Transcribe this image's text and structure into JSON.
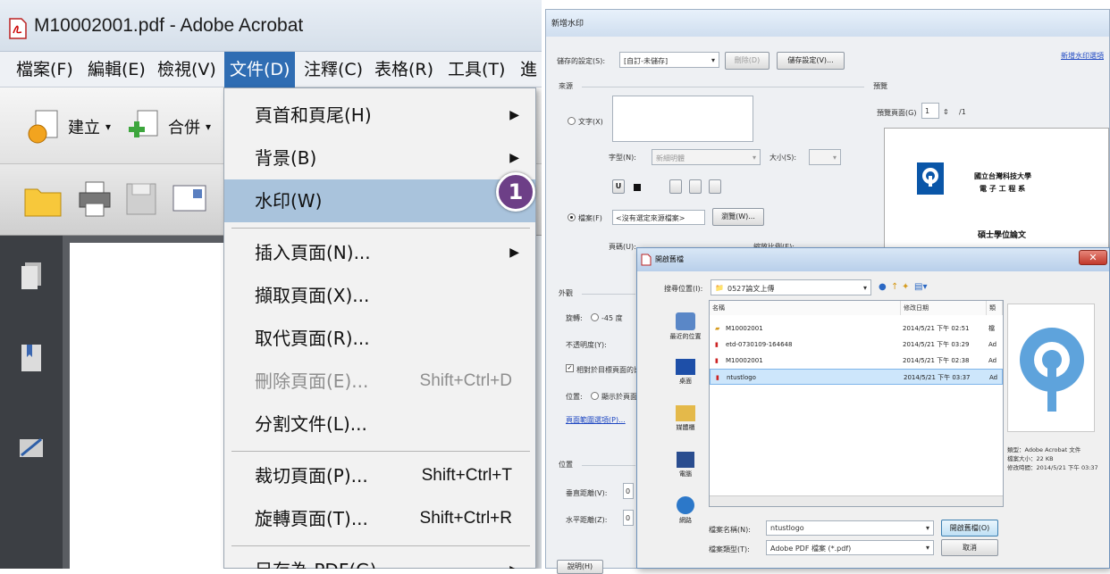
{
  "acrobat": {
    "title": "M10002001.pdf - Adobe Acrobat",
    "menu": [
      "檔案(F)",
      "編輯(E)",
      "檢視(V)",
      "文件(D)",
      "注釋(C)",
      "表格(R)",
      "工具(T)",
      "進"
    ],
    "active_menu_index": 3,
    "toolbar": {
      "create_label": "建立",
      "combine_label": "合併"
    },
    "dropdown": [
      {
        "label": "頁首和頁尾(H)",
        "shortcut": "",
        "submenu": true
      },
      {
        "label": "背景(B)",
        "shortcut": "",
        "submenu": true
      },
      {
        "label": "水印(W)",
        "shortcut": "",
        "submenu": false
      },
      {
        "label": "插入頁面(N)...",
        "shortcut": "",
        "submenu": true
      },
      {
        "label": "擷取頁面(X)...",
        "shortcut": "",
        "submenu": false
      },
      {
        "label": "取代頁面(R)...",
        "shortcut": "",
        "submenu": false
      },
      {
        "label": "刪除頁面(E)...",
        "shortcut": "Shift+Ctrl+D",
        "submenu": false
      },
      {
        "label": "分割文件(L)...",
        "shortcut": "",
        "submenu": false
      },
      {
        "label": "裁切頁面(P)...",
        "shortcut": "Shift+Ctrl+T",
        "submenu": false
      },
      {
        "label": "旋轉頁面(T)...",
        "shortcut": "Shift+Ctrl+R",
        "submenu": false
      },
      {
        "label": "另存為 PDF(G)...",
        "shortcut": "",
        "submenu": true
      }
    ],
    "step_badge": "1"
  },
  "watermark": {
    "title": "新增水印",
    "saved_settings_label": "儲存的設定(S):",
    "saved_settings_value": "[自訂-未儲存]",
    "delete_button": "刪除(D)",
    "save_settings_button": "儲存設定(V)...",
    "source_label": "來源",
    "text_label": "文字(X)",
    "font_label": "字型(N):",
    "font_value": "新細明體",
    "size_label": "大小(S):",
    "file_label": "檔案(F)",
    "file_value": "<沒有選定來源檔案>",
    "browse_button": "瀏覽(W)...",
    "page_label": "頁碼(U):",
    "abs_scale_label": "縮放比例(E):",
    "appearance_label": "外觀",
    "rotation_label": "旋轉:",
    "rotation_value": "-45 度",
    "opacity_label": "不透明度(Y):",
    "relative_scale": "相對於目標頁面的比例",
    "location_label": "位置:",
    "location_value": "顯示於頁面上",
    "page_range_link": "頁面範圍選項(P)...",
    "position_label": "位置",
    "vertical_label": "垂直距離(V):",
    "horizontal_label": "水平距離(Z):",
    "help_button": "說明(H)",
    "preview_label": "預覽",
    "preview_page_label": "預覽頁面(G)",
    "preview_page_value": "1",
    "preview_page_total": "/1",
    "preview_university": "國立台灣科技大學",
    "preview_dept": "電 子 工 程 系",
    "preview_thesis": "碩士學位論文",
    "top_right_link": "新增水印選項"
  },
  "open_dialog": {
    "title": "開啟舊檔",
    "look_in_label": "搜尋位置(I):",
    "look_in_value": "0527論文上傳",
    "columns": [
      "名稱",
      "修改日期",
      "類"
    ],
    "files": [
      {
        "name": "M10002001",
        "date": "2014/5/21 下午 02:51",
        "type": "檔",
        "icon": "folder",
        "selected": false
      },
      {
        "name": "etd-0730109-164648",
        "date": "2014/5/21 下午 03:29",
        "type": "Ad",
        "icon": "pdf",
        "selected": false
      },
      {
        "name": "M10002001",
        "date": "2014/5/21 下午 02:38",
        "type": "Ad",
        "icon": "pdf",
        "selected": false
      },
      {
        "name": "ntustlogo",
        "date": "2014/5/21 下午 03:37",
        "type": "Ad",
        "icon": "pdf",
        "selected": true
      }
    ],
    "nav": [
      "最近的位置",
      "桌面",
      "媒體櫃",
      "電腦",
      "網路"
    ],
    "filename_label": "檔案名稱(N):",
    "filename_value": "ntustlogo",
    "filetype_label": "檔案類型(T):",
    "filetype_value": "Adobe PDF 檔案 (*.pdf)",
    "open_button": "開啟舊檔(O)",
    "cancel_button": "取消",
    "info_type": "類型：Adobe Acrobat 文件",
    "info_size": "檔案大小：22 KB",
    "info_modified": "修改時間：2014/5/21 下午 03:37"
  }
}
